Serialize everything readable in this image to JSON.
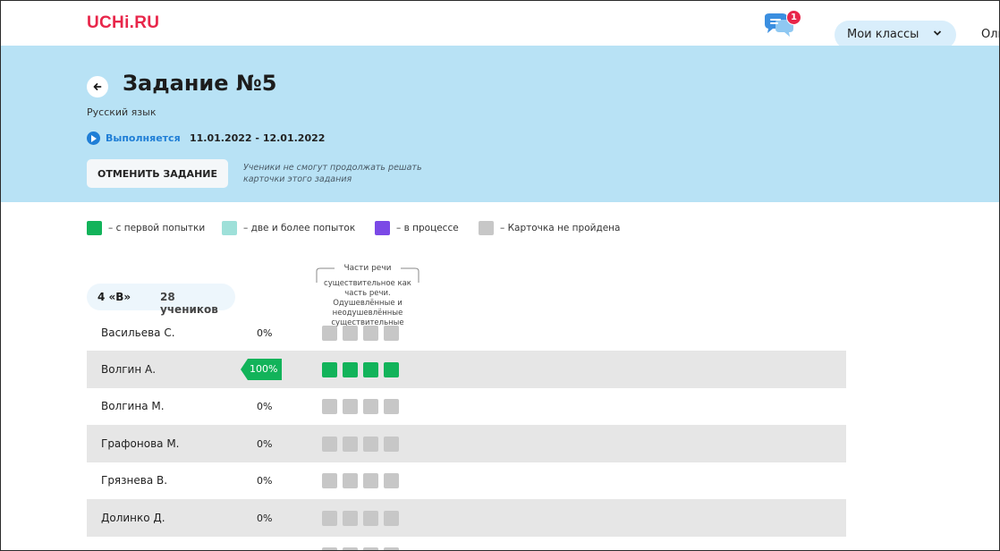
{
  "header": {
    "logo": "UCHi.RU",
    "chat_badge": "1",
    "classes_button": "Мои классы",
    "user_name": "Ольга"
  },
  "task": {
    "title": "Задание №5",
    "subject": "Русский язык",
    "status": "Выполняется",
    "dates": "11.01.2022 - 12.01.2022",
    "cancel_button": "ОТМЕНИТЬ ЗАДАНИЕ",
    "cancel_note": "Ученики не смогут продолжать решать карточки этого задания"
  },
  "legend": [
    {
      "label": "– с первой попытки",
      "color": "#12b35a"
    },
    {
      "label": "– две и более попыток",
      "color": "#9ee0d9"
    },
    {
      "label": "– в процессе",
      "color": "#7b49e6"
    },
    {
      "label": "– Карточка не пройдена",
      "color": "#c7c7c7"
    }
  ],
  "class_info": {
    "name": "4 «В»",
    "count": "28 учеников"
  },
  "topic": {
    "group": "Части речи",
    "name": "существительное как часть речи. Одушевлённые и неодушевлённые существительные"
  },
  "students": [
    {
      "name": "Васильева С.",
      "percent": "0%",
      "cells": [
        "gray",
        "gray",
        "gray",
        "gray"
      ]
    },
    {
      "name": "Волгин А.",
      "percent": "100%",
      "highlight": true,
      "cells": [
        "green",
        "green",
        "green",
        "green"
      ]
    },
    {
      "name": "Волгина М.",
      "percent": "0%",
      "cells": [
        "gray",
        "gray",
        "gray",
        "gray"
      ]
    },
    {
      "name": "Графонова М.",
      "percent": "0%",
      "cells": [
        "gray",
        "gray",
        "gray",
        "gray"
      ]
    },
    {
      "name": "Грязнева В.",
      "percent": "0%",
      "cells": [
        "gray",
        "gray",
        "gray",
        "gray"
      ]
    },
    {
      "name": "Долинко Д.",
      "percent": "0%",
      "cells": [
        "gray",
        "gray",
        "gray",
        "gray"
      ]
    }
  ]
}
